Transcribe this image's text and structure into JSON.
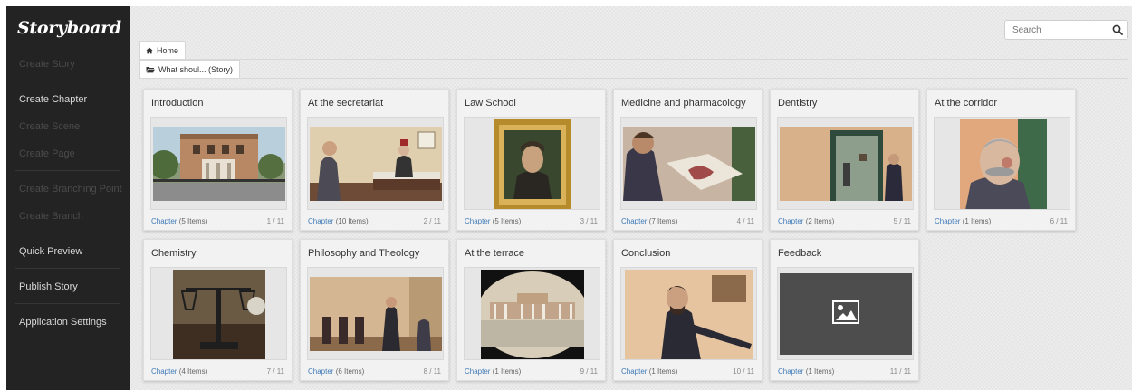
{
  "app": {
    "logo": "Storyboard"
  },
  "sidebar": {
    "items": [
      {
        "label": "Create Story",
        "enabled": false
      },
      {
        "label": "Create Chapter",
        "enabled": true
      },
      {
        "label": "Create Scene",
        "enabled": false
      },
      {
        "label": "Create Page",
        "enabled": false
      },
      {
        "label": "Create Branching Point",
        "enabled": false
      },
      {
        "label": "Create Branch",
        "enabled": false
      },
      {
        "label": "Quick Preview",
        "enabled": true
      },
      {
        "label": "Publish Story",
        "enabled": true
      },
      {
        "label": "Application Settings",
        "enabled": true
      }
    ]
  },
  "search": {
    "placeholder": "Search",
    "icon": "search-icon"
  },
  "breadcrumb": {
    "home": {
      "label": "Home",
      "icon": "home-icon"
    },
    "story": {
      "label": "What shoul... (Story)",
      "icon": "folder-icon"
    }
  },
  "cards": [
    {
      "title": "Introduction",
      "type": "Chapter",
      "items": "(5 Items)",
      "count": "1 / 11"
    },
    {
      "title": "At the secretariat",
      "type": "Chapter",
      "items": "(10 Items)",
      "count": "2 / 11"
    },
    {
      "title": "Law School",
      "type": "Chapter",
      "items": "(5 Items)",
      "count": "3 / 11"
    },
    {
      "title": "Medicine and pharmacology",
      "type": "Chapter",
      "items": "(7 Items)",
      "count": "4 / 11"
    },
    {
      "title": "Dentistry",
      "type": "Chapter",
      "items": "(2 Items)",
      "count": "5 / 11"
    },
    {
      "title": "At the corridor",
      "type": "Chapter",
      "items": "(1 Items)",
      "count": "6 / 11"
    },
    {
      "title": "Chemistry",
      "type": "Chapter",
      "items": "(4 Items)",
      "count": "7 / 11"
    },
    {
      "title": "Philosophy and Theology",
      "type": "Chapter",
      "items": "(6 Items)",
      "count": "8 / 11"
    },
    {
      "title": "At the terrace",
      "type": "Chapter",
      "items": "(1 Items)",
      "count": "9 / 11"
    },
    {
      "title": "Conclusion",
      "type": "Chapter",
      "items": "(1 Items)",
      "count": "10 / 11"
    },
    {
      "title": "Feedback",
      "type": "Chapter",
      "items": "(1 Items)",
      "count": "11 / 11"
    }
  ],
  "colors": {
    "sidebar_bg": "#232323",
    "main_bg": "#ececec",
    "link": "#3f7ab8",
    "placeholder_bg": "#4d4d4d"
  }
}
